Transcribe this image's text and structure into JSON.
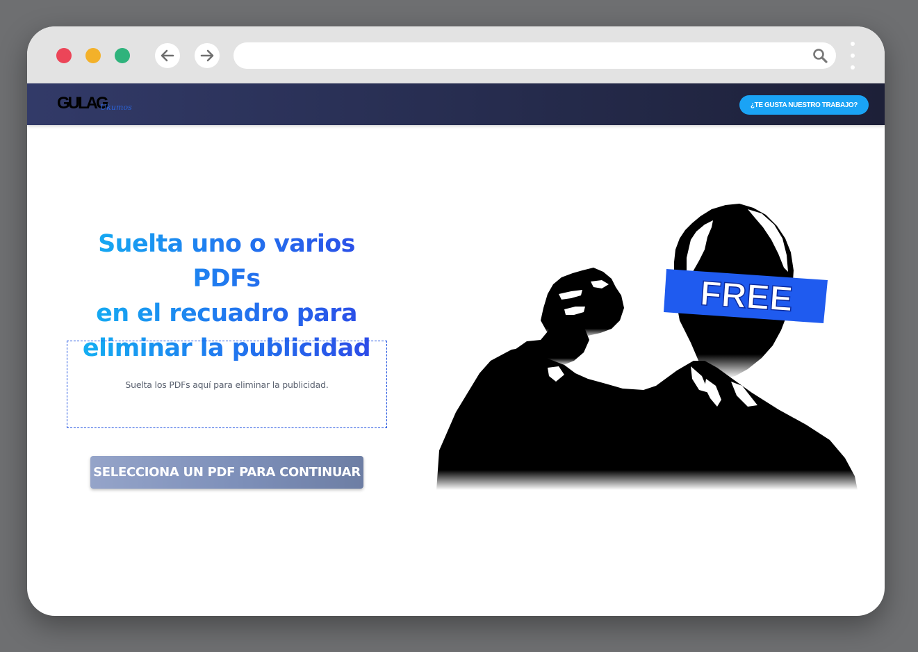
{
  "colors": {
    "background": "#6e6f71",
    "header_start": "#323a68",
    "header_end": "#1d2038",
    "accent_blue": "#1aa3f5",
    "headline_start": "#12b6f2",
    "headline_end": "#2e45e6",
    "dropzone_border": "#1f52e0",
    "button_gray_blue": "#7d8fb9",
    "free_band": "#1f5bef"
  },
  "browser": {
    "traffic_lights": [
      "red-dot",
      "yellow-dot",
      "green-dot"
    ],
    "back_icon": "arrow-left-icon",
    "forward_icon": "arrow-right-icon",
    "address_value": "",
    "search_icon": "search-icon",
    "menu_icon": "kebab-menu-icon"
  },
  "header": {
    "logo_main": "GULAG",
    "logo_sub": "Ukumos",
    "cta_label": "¿TE GUSTA NUESTRO TRABAJO?"
  },
  "main": {
    "headline_line1": "Suelta uno o varios PDFs",
    "headline_line2": "en el recuadro para",
    "headline_line3": "eliminar la publicidad",
    "dropzone_text": "Suelta los PDFs aquí para eliminar la publicidad.",
    "select_button": "SELECCIONA UN PDF PARA CONTINUAR"
  },
  "illustration": {
    "badge_text": "FREE"
  }
}
